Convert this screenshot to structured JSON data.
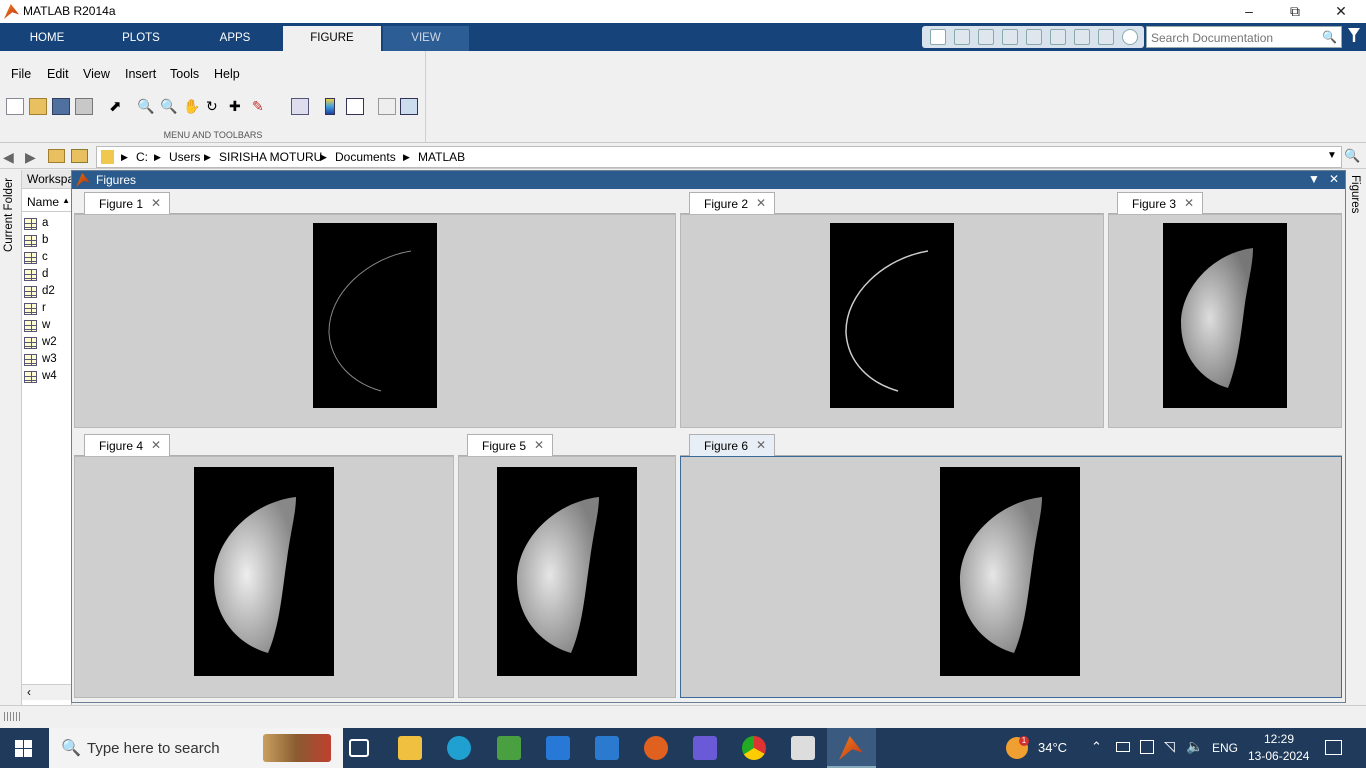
{
  "window": {
    "title": "MATLAB R2014a"
  },
  "ribbon": {
    "tabs": [
      {
        "label": "HOME"
      },
      {
        "label": "PLOTS"
      },
      {
        "label": "APPS"
      },
      {
        "label": "FIGURE"
      },
      {
        "label": "VIEW"
      }
    ],
    "active_tab": "FIGURE",
    "menus": [
      "File",
      "Edit",
      "View",
      "Insert",
      "Tools",
      "Help"
    ],
    "section_label": "MENU AND TOOLBARS",
    "accent_color": "#16437a"
  },
  "search": {
    "placeholder": "Search Documentation"
  },
  "address": {
    "crumbs": [
      "C:",
      "Users",
      "SIRISHA MOTURU",
      "Documents",
      "MATLAB"
    ]
  },
  "left_panel": {
    "current_folder_label": "Current Folder",
    "workspace_title": "Workspace",
    "column_header": "Name",
    "variables": [
      "a",
      "b",
      "c",
      "d",
      "d2",
      "r",
      "w",
      "w2",
      "w3",
      "w4"
    ]
  },
  "figures_window": {
    "title": "Figures",
    "side_label": "Figures",
    "tabs": [
      {
        "label": "Figure 1"
      },
      {
        "label": "Figure 2"
      },
      {
        "label": "Figure 3"
      },
      {
        "label": "Figure 4"
      },
      {
        "label": "Figure 5"
      },
      {
        "label": "Figure 6"
      }
    ]
  },
  "taskbar": {
    "search_placeholder": "Type here to search",
    "weather": "34°C",
    "language": "ENG",
    "time": "12:29",
    "date": "13-06-2024",
    "weather_badge": "1"
  }
}
